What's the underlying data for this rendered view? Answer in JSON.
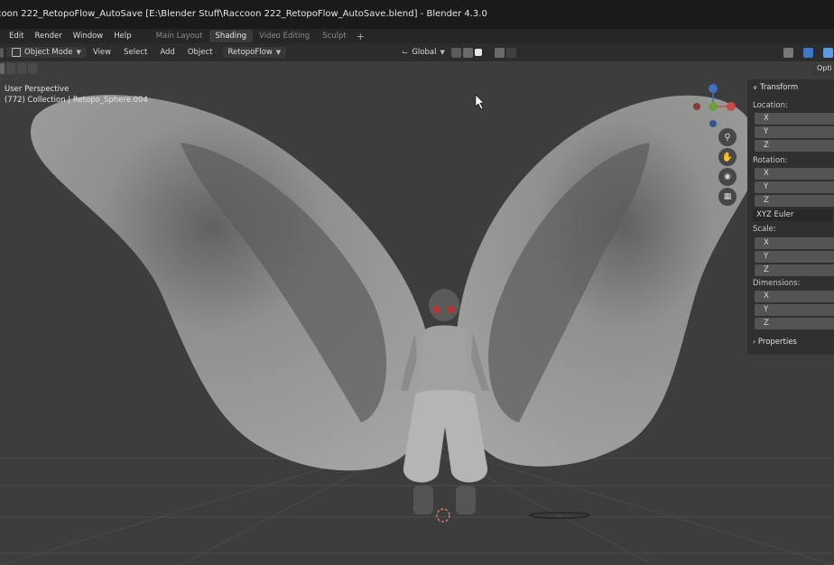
{
  "window": {
    "title": "coon 222_RetopoFlow_AutoSave [E:\\Blender Stuff\\Raccoon 222_RetopoFlow_AutoSave.blend] - Blender 4.3.0"
  },
  "menubar": {
    "items": [
      "Edit",
      "Render",
      "Window",
      "Help"
    ],
    "workspaces": [
      {
        "label": "Main Layout",
        "active": false
      },
      {
        "label": "Shading",
        "active": true
      },
      {
        "label": "Video Editing",
        "active": false
      },
      {
        "label": "Sculpt",
        "active": false
      }
    ],
    "add_tab": "+"
  },
  "header": {
    "mode": "Object Mode",
    "menus": [
      "View",
      "Select",
      "Add",
      "Object"
    ],
    "addon": "RetopoFlow",
    "orientation": "Global",
    "options_label": "Opti"
  },
  "viewport": {
    "perspective": "User Perspective",
    "collection": "(772) Collection | Retopo_Sphere.004",
    "axis_colors": {
      "x": "#c94a4a",
      "y": "#6f9e3a",
      "z": "#3f6fc0"
    }
  },
  "npanel": {
    "transform_header": "Transform",
    "location_label": "Location:",
    "rotation_label": "Rotation:",
    "rotation_mode": "XYZ Euler",
    "scale_label": "Scale:",
    "dimensions_label": "Dimensions:",
    "properties_header": "Properties",
    "axes": [
      "X",
      "Y",
      "Z"
    ]
  }
}
